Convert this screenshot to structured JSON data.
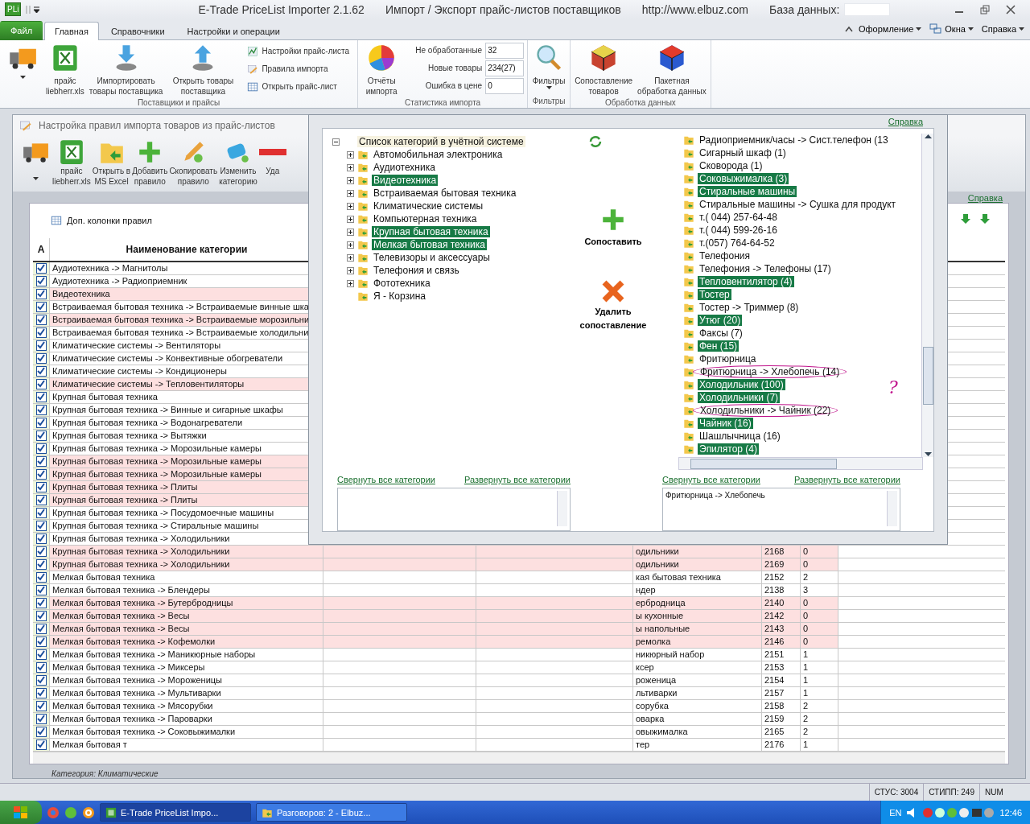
{
  "app": {
    "icon": "PLi",
    "title": "E-Trade PriceList Importer 2.1.62",
    "subtitle": "Импорт / Экспорт прайс-листов поставщиков",
    "url": "http://www.elbuz.com",
    "database_label": "База данных:"
  },
  "ribbon_tabs": [
    {
      "label": "Файл",
      "kind": "file",
      "selected": false
    },
    {
      "label": "Главная",
      "kind": "tab",
      "selected": true
    },
    {
      "label": "Справочники",
      "kind": "tab",
      "selected": false
    },
    {
      "label": "Настройки и операции",
      "kind": "tab",
      "selected": false
    }
  ],
  "ribbon_menus": [
    {
      "label": "Оформление",
      "kind": "plain"
    },
    {
      "label": "Окна",
      "kind": "windows"
    },
    {
      "label": "Справка",
      "kind": "plain"
    }
  ],
  "ribbon": {
    "suppliers_group": {
      "label": "Поставщики и прайсы",
      "buttons": [
        {
          "kind": "truck"
        },
        {
          "kind": "excel",
          "lines": [
            "прайс",
            "liebherr.xls"
          ]
        },
        {
          "kind": "import",
          "lines": [
            "Импортировать",
            "товары поставщика"
          ]
        },
        {
          "kind": "export",
          "lines": [
            "Открыть товары",
            "поставщика"
          ]
        }
      ],
      "small_buttons": [
        {
          "kind": "settings",
          "label": "Настройки прайс-листа"
        },
        {
          "kind": "rules",
          "label": "Правила импорта"
        },
        {
          "kind": "table",
          "label": "Открыть прайс-лист"
        }
      ]
    },
    "stats_group": {
      "label": "Статистика импорта",
      "button": {
        "kind": "chart",
        "lines": [
          "Отчёты",
          "импорта"
        ]
      },
      "fields": [
        {
          "label": "Не обработанные",
          "value": "32"
        },
        {
          "label": "Новые товары",
          "value": "234(27)"
        },
        {
          "label": "Ошибка в цене",
          "value": "0"
        }
      ]
    },
    "filters_group": {
      "label": "Фильтры",
      "button": {
        "kind": "search",
        "lines": [
          "Фильтры"
        ]
      }
    },
    "processing_group": {
      "label": "Обработка данных",
      "buttons": [
        {
          "kind": "cube",
          "lines": [
            "Сопоставление",
            "товаров"
          ]
        },
        {
          "kind": "cube2",
          "lines": [
            "Пакетная",
            "обработка данных"
          ]
        }
      ]
    }
  },
  "rules_window": {
    "title": "Настройка правил импорта товаров из прайс-листов",
    "toolbar": [
      {
        "kind": "truck"
      },
      {
        "kind": "excel",
        "lines": [
          "прайс",
          "liebherr.xls"
        ]
      },
      {
        "kind": "folder",
        "lines": [
          "Открыть в",
          "MS Excel"
        ]
      },
      {
        "kind": "plus",
        "lines": [
          "Добавить",
          "правило"
        ]
      },
      {
        "kind": "pencil",
        "lines": [
          "Скопировать",
          "правило"
        ]
      },
      {
        "kind": "tag",
        "lines": [
          "Изменить",
          "категорию"
        ]
      },
      {
        "kind": "minus",
        "lines": [
          "Уда"
        ]
      }
    ],
    "help_link": "Справка",
    "columns_button": "Доп. колонки правил",
    "columns": [
      "A",
      "Наименование категории"
    ],
    "rows": [
      {
        "name": "Аудиотехника -> Магнитолы",
        "checked": true,
        "error": false
      },
      {
        "name": "Аудиотехника -> Радиоприемник",
        "checked": true,
        "error": false
      },
      {
        "name": "Видеотехника",
        "checked": true,
        "error": true
      },
      {
        "name": "Встраиваемая бытовая техника -> Встраиваемые винные шка",
        "checked": true,
        "error": false
      },
      {
        "name": "Встраиваемая бытовая техника -> Встраиваемые морозильни",
        "checked": true,
        "error": true
      },
      {
        "name": "Встраиваемая бытовая техника -> Встраиваемые холодильни",
        "checked": true,
        "error": false
      },
      {
        "name": "Климатические системы -> Вентиляторы",
        "checked": true,
        "error": false
      },
      {
        "name": "Климатические системы -> Конвективные обогреватели",
        "checked": true,
        "error": false
      },
      {
        "name": "Климатические системы -> Кондиционеры",
        "checked": true,
        "error": false
      },
      {
        "name": "Климатические системы -> Тепловентиляторы",
        "checked": true,
        "error": true
      },
      {
        "name": "Крупная бытовая техника",
        "checked": true,
        "error": false
      },
      {
        "name": "Крупная бытовая техника -> Винные и сигарные шкафы",
        "checked": true,
        "error": false
      },
      {
        "name": "Крупная бытовая техника -> Водонагреватели",
        "checked": true,
        "error": false
      },
      {
        "name": "Крупная бытовая техника -> Вытяжки",
        "checked": true,
        "error": false
      },
      {
        "name": "Крупная бытовая техника -> Морозильные камеры",
        "checked": true,
        "error": false
      },
      {
        "name": "Крупная бытовая техника -> Морозильные камеры",
        "checked": true,
        "error": true
      },
      {
        "name": "Крупная бытовая техника -> Морозильные камеры",
        "checked": true,
        "error": true
      },
      {
        "name": "Крупная бытовая техника -> Плиты",
        "checked": true,
        "error": true
      },
      {
        "name": "Крупная бытовая техника -> Плиты",
        "checked": true,
        "error": true
      },
      {
        "name": "Крупная бытовая техника -> Посудомоечные машины",
        "checked": true,
        "error": false
      },
      {
        "name": "Крупная бытовая техника -> Стиральные машины",
        "checked": true,
        "error": false
      },
      {
        "name": "Крупная бытовая техника -> Холодильники",
        "checked": true,
        "error": false
      },
      {
        "name": "Крупная бытовая техника -> Холодильники",
        "checked": true,
        "error": true,
        "column_5": "одильники",
        "column_6": "2168",
        "column_7": "0"
      },
      {
        "name": "Крупная бытовая техника -> Холодильники",
        "checked": true,
        "error": true,
        "column_5": "одильники",
        "column_6": "2169",
        "column_7": "0"
      },
      {
        "name": "Мелкая бытовая техника",
        "checked": true,
        "error": false,
        "column_5": "кая бытовая техника",
        "column_6": "2152",
        "column_7": "2"
      },
      {
        "name": "Мелкая бытовая техника -> Блендеры",
        "checked": true,
        "error": false,
        "column_5": "ндер",
        "column_6": "2138",
        "column_7": "3"
      },
      {
        "name": "Мелкая бытовая техника -> Бутербродницы",
        "checked": true,
        "error": true,
        "column_5": "ербродница",
        "column_6": "2140",
        "column_7": "0"
      },
      {
        "name": "Мелкая бытовая техника -> Весы",
        "checked": true,
        "error": true,
        "column_5": "ы кухонные",
        "column_6": "2142",
        "column_7": "0"
      },
      {
        "name": "Мелкая бытовая техника -> Весы",
        "checked": true,
        "error": true,
        "column_5": "ы напольные",
        "column_6": "2143",
        "column_7": "0"
      },
      {
        "name": "Мелкая бытовая техника -> Кофемолки",
        "checked": true,
        "error": true,
        "column_5": "ремолка",
        "column_6": "2146",
        "column_7": "0"
      },
      {
        "name": "Мелкая бытовая техника -> Маникюрные наборы",
        "checked": true,
        "error": false,
        "column_5": "никюрный набор",
        "column_6": "2151",
        "column_7": "1"
      },
      {
        "name": "Мелкая бытовая техника -> Миксеры",
        "checked": true,
        "error": false,
        "column_5": "ксер",
        "column_6": "2153",
        "column_7": "1"
      },
      {
        "name": "Мелкая бытовая техника -> Мороженицы",
        "checked": true,
        "error": false,
        "column_5": "роженица",
        "column_6": "2154",
        "column_7": "1"
      },
      {
        "name": "Мелкая бытовая техника -> Мультиварки",
        "checked": true,
        "error": false,
        "column_5": "льтиварки",
        "column_6": "2157",
        "column_7": "1"
      },
      {
        "name": "Мелкая бытовая техника -> Мясорубки",
        "checked": true,
        "error": false,
        "column_5": "сорубка",
        "column_6": "2158",
        "column_7": "2"
      },
      {
        "name": "Мелкая бытовая техника -> Пароварки",
        "checked": true,
        "error": false,
        "column_5": "оварка",
        "column_6": "2159",
        "column_7": "2"
      },
      {
        "name": "Мелкая бытовая техника -> Соковыжималки",
        "checked": true,
        "error": false,
        "column_5": "овыжималка",
        "column_6": "2165",
        "column_7": "2"
      },
      {
        "name": "Мелкая бытовая т",
        "checked": true,
        "error": false,
        "column_5": "тер",
        "column_6": "2176",
        "column_7": "1"
      }
    ],
    "footer": "Категория: Климатические"
  },
  "match_dialog": {
    "help_link": "Справка",
    "tree": {
      "root": "Список категорий в учётной системе",
      "expanded": true,
      "items": [
        {
          "label": "Автомобильная электроника",
          "selected": false,
          "expandable": true
        },
        {
          "label": "Аудиотехника",
          "selected": false,
          "expandable": true
        },
        {
          "label": "Видеотехника",
          "selected": true,
          "expandable": true
        },
        {
          "label": "Встраиваемая бытовая техника",
          "selected": false,
          "expandable": true
        },
        {
          "label": "Климатические системы",
          "selected": false,
          "expandable": true
        },
        {
          "label": "Компьютерная техника",
          "selected": false,
          "expandable": true
        },
        {
          "label": "Крупная бытовая техника",
          "selected": true,
          "expandable": true
        },
        {
          "label": "Мелкая бытовая техника",
          "selected": true,
          "expandable": true
        },
        {
          "label": "Телевизоры и аксессуары",
          "selected": false,
          "expandable": true
        },
        {
          "label": "Телефония и связь",
          "selected": false,
          "expandable": true
        },
        {
          "label": "Фототехника",
          "selected": false,
          "expandable": true
        },
        {
          "label": "Я - Корзина",
          "selected": false,
          "expandable": false
        }
      ]
    },
    "match_button": "Сопоставить",
    "delete_button": [
      "Удалить",
      "сопоставление"
    ],
    "supplier_items": [
      {
        "label": "Радиоприемник/часы -> Сист.телефон (13",
        "selected": false,
        "circled": false
      },
      {
        "label": "Сигарный шкаф (1)",
        "selected": false,
        "circled": false
      },
      {
        "label": "Сковорода (1)",
        "selected": false,
        "circled": false
      },
      {
        "label": "Соковыжималка (3)",
        "selected": true,
        "circled": false
      },
      {
        "label": "Стиральные машины",
        "selected": true,
        "circled": false
      },
      {
        "label": "Стиральные машины -> Сушка для продукт",
        "selected": false,
        "circled": false
      },
      {
        "label": "т.( 044) 257-64-48",
        "selected": false,
        "circled": false
      },
      {
        "label": "т.( 044) 599-26-16",
        "selected": false,
        "circled": false
      },
      {
        "label": "т.(057) 764-64-52",
        "selected": false,
        "circled": false
      },
      {
        "label": "Телефония",
        "selected": false,
        "circled": false
      },
      {
        "label": "Телефония -> Телефоны (17)",
        "selected": false,
        "circled": false
      },
      {
        "label": "Тепловентилятор (4)",
        "selected": true,
        "circled": false
      },
      {
        "label": "Тостер",
        "selected": true,
        "circled": false
      },
      {
        "label": "Тостер -> Триммер (8)",
        "selected": false,
        "circled": false
      },
      {
        "label": "Утюг (20)",
        "selected": true,
        "circled": false
      },
      {
        "label": "Факсы (7)",
        "selected": false,
        "circled": false
      },
      {
        "label": "Фен (15)",
        "selected": true,
        "circled": false
      },
      {
        "label": "Фритюрница",
        "selected": false,
        "circled": false
      },
      {
        "label": "Фритюрница -> Хлебопечь (14)",
        "selected": false,
        "circled": true
      },
      {
        "label": "Холодильник (100)",
        "selected": true,
        "circled": false
      },
      {
        "label": "Холодильники (7)",
        "selected": true,
        "circled": false
      },
      {
        "label": "Холодильники -> Чайник (22)",
        "selected": false,
        "circled": true
      },
      {
        "label": "Чайник (16)",
        "selected": true,
        "circled": false
      },
      {
        "label": "Шашлычница (16)",
        "selected": false,
        "circled": false
      },
      {
        "label": "Эпилятор (4)",
        "selected": true,
        "circled": false
      }
    ],
    "annotation": "?",
    "left_links": [
      "Свернуть все категории",
      "Развернуть все категории"
    ],
    "right_links": [
      "Свернуть все категории",
      "Развернуть все категории"
    ],
    "right_text": "Фритюрница -> Хлебопечь"
  },
  "status_bar": [
    "СТУС: 3004",
    "СТИПП: 249",
    "NUM"
  ],
  "taskbar": {
    "tasks": [
      {
        "label": "E-Trade PriceList Impo...",
        "kind": "app",
        "selected": true
      },
      {
        "label": "Разговоров: 2 - Elbuz...",
        "kind": "folder",
        "selected": false
      }
    ],
    "language": "EN",
    "time": "12:46"
  }
}
